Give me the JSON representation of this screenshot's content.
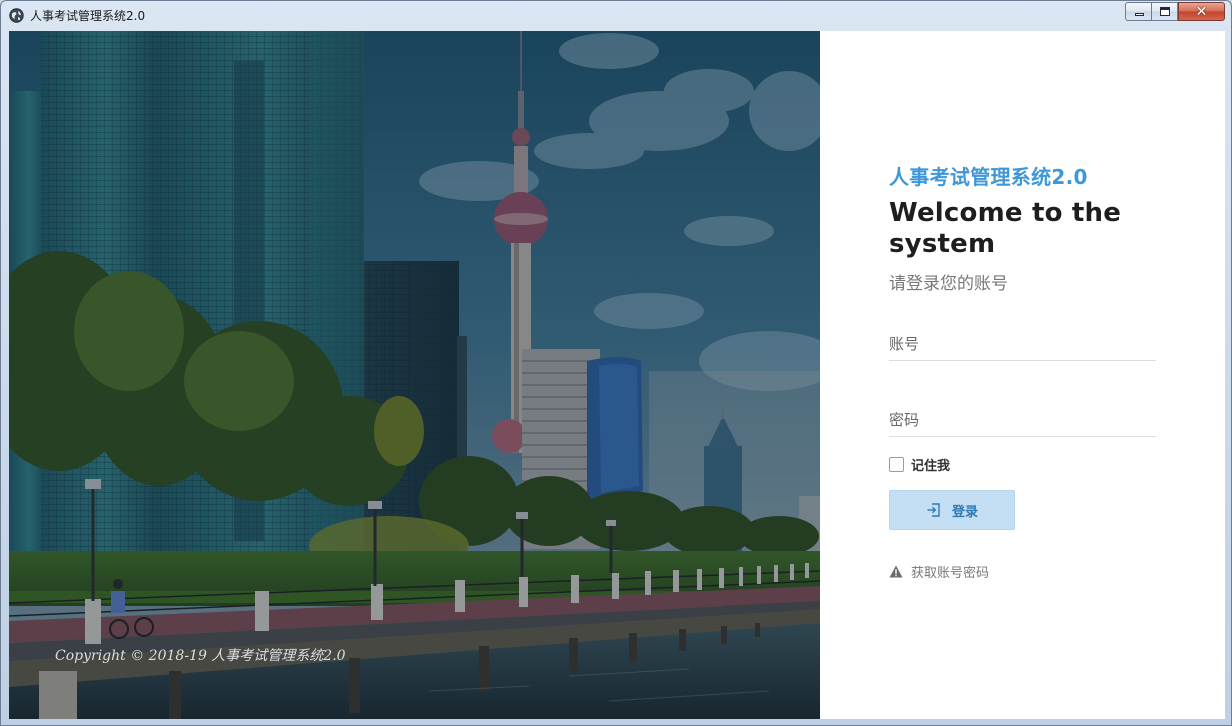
{
  "window": {
    "title": "人事考试管理系统2.0",
    "app_icon": "globe-icon",
    "controls": {
      "minimize": "minimize-icon",
      "maximize": "maximize-icon",
      "close": "close-icon",
      "close_glyph": "✕"
    }
  },
  "hero": {
    "copyright": "Copyright © 2018-19 人事考试管理系统2.0"
  },
  "login": {
    "system_title": "人事考试管理系统2.0",
    "welcome": "Welcome to the system",
    "subtitle": "请登录您的账号",
    "username_placeholder": "账号",
    "password_placeholder": "密码",
    "remember_label": "记住我",
    "login_button": "登录",
    "login_icon": "sign-in-icon",
    "forgot_label": "获取账号密码",
    "forgot_icon": "warning-icon"
  },
  "colors": {
    "accent": "#3d97d8",
    "button_bg": "#c4def3",
    "button_text": "#2f79b5",
    "heading": "#1e1e1e"
  }
}
